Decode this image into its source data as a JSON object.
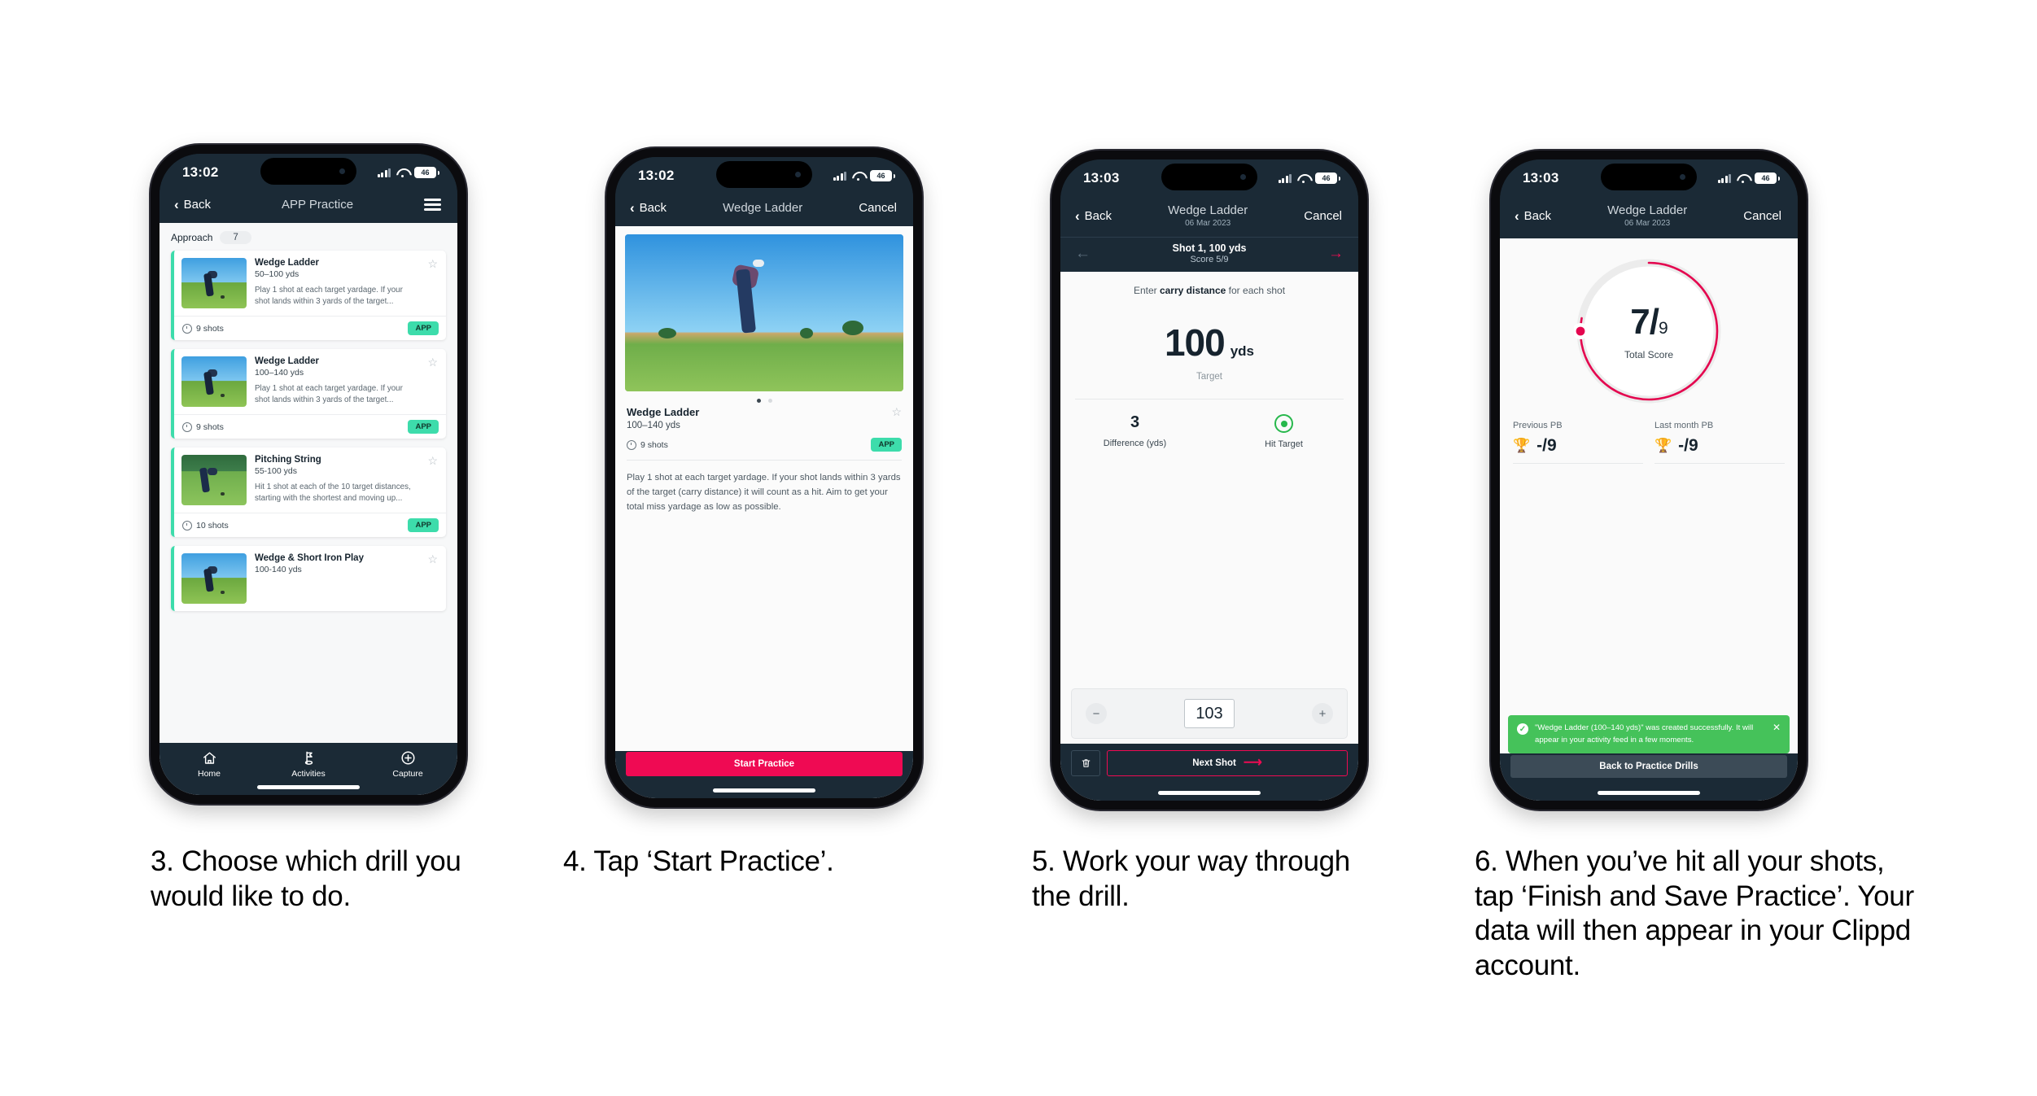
{
  "colors": {
    "dark_navy": "#1b2a36",
    "pink": "#ef0a53",
    "teal": "#3ddcab",
    "green_toast": "#45c25a",
    "hit_green": "#27b84c"
  },
  "phones": [
    {
      "id": "phone-3-choose-drill",
      "status": {
        "time": "13:02",
        "battery": "46"
      },
      "nav": {
        "back": "Back",
        "title": "APP Practice",
        "menu_icon": "hamburger-icon"
      },
      "filter": {
        "label": "Approach",
        "count": "7"
      },
      "cards": [
        {
          "title": "Wedge Ladder",
          "range": "50–100 yds",
          "desc": "Play 1 shot at each target yardage. If your shot lands within 3 yards of the target...",
          "shots": "9 shots",
          "tag": "APP"
        },
        {
          "title": "Wedge Ladder",
          "range": "100–140 yds",
          "desc": "Play 1 shot at each target yardage. If your shot lands within 3 yards of the target...",
          "shots": "9 shots",
          "tag": "APP"
        },
        {
          "title": "Pitching String",
          "range": "55-100 yds",
          "desc": "Hit 1 shot at each of the 10 target distances, starting with the shortest and moving up...",
          "shots": "10 shots",
          "tag": "APP"
        },
        {
          "title": "Wedge & Short Iron Play",
          "range": "100-140 yds",
          "desc": "",
          "shots": "",
          "tag": ""
        }
      ],
      "tabs": [
        {
          "label": "Home",
          "icon": "home-icon"
        },
        {
          "label": "Activities",
          "icon": "golf-flag-icon"
        },
        {
          "label": "Capture",
          "icon": "plus-circle-icon"
        }
      ]
    },
    {
      "id": "phone-4-start-practice",
      "status": {
        "time": "13:02",
        "battery": "46"
      },
      "nav": {
        "back": "Back",
        "title": "Wedge Ladder",
        "cancel": "Cancel"
      },
      "detail": {
        "title": "Wedge Ladder",
        "range": "100–140 yds",
        "shots": "9 shots",
        "tag": "APP",
        "description": "Play 1 shot at each target yardage. If your shot lands within 3 yards of the target (carry distance) it will count as a hit. Aim to get your total miss yardage as low as possible."
      },
      "start_button": "Start Practice"
    },
    {
      "id": "phone-5-enter-shots",
      "status": {
        "time": "13:03",
        "battery": "46"
      },
      "nav": {
        "back": "Back",
        "title": "Wedge Ladder",
        "subtitle": "06 Mar 2023",
        "cancel": "Cancel"
      },
      "shotbar": {
        "title": "Shot 1, 100 yds",
        "score": "Score 5/9"
      },
      "prompt_prefix": "Enter ",
      "prompt_bold": "carry distance",
      "prompt_suffix": " for each shot",
      "target": {
        "value": "100",
        "unit": "yds",
        "label": "Target"
      },
      "metrics": [
        {
          "value": "3",
          "label": "Difference (yds)"
        },
        {
          "value": "",
          "label": "Hit Target",
          "icon": "hit-target-icon"
        }
      ],
      "stepper": {
        "minus": "−",
        "value": "103",
        "plus": "+"
      },
      "footer": {
        "delete_icon": "trash-icon",
        "next": "Next Shot"
      }
    },
    {
      "id": "phone-6-summary",
      "status": {
        "time": "13:03",
        "battery": "46"
      },
      "nav": {
        "back": "Back",
        "title": "Wedge Ladder",
        "subtitle": "06 Mar 2023",
        "cancel": "Cancel"
      },
      "score": {
        "value": "7",
        "total": "9",
        "label": "Total Score",
        "percent": 78
      },
      "pbs": [
        {
          "label": "Previous PB",
          "value": "-/9",
          "icon": "trophy-icon"
        },
        {
          "label": "Last month PB",
          "value": "-/9",
          "icon": "trophy-icon"
        }
      ],
      "toast": {
        "message": "\"Wedge Ladder (100–140 yds)\" was created successfully. It will appear in your activity feed in a few moments.",
        "close_icon": "close-icon",
        "check_icon": "check-icon"
      },
      "button": "Back to Practice Drills"
    }
  ],
  "captions": [
    "3. Choose which drill you would like to do.",
    "4. Tap ‘Start Practice’.",
    "5. Work your way through the drill.",
    "6. When you’ve hit all your shots, tap ‘Finish and Save Practice’. Your data will then appear in your Clippd account."
  ]
}
